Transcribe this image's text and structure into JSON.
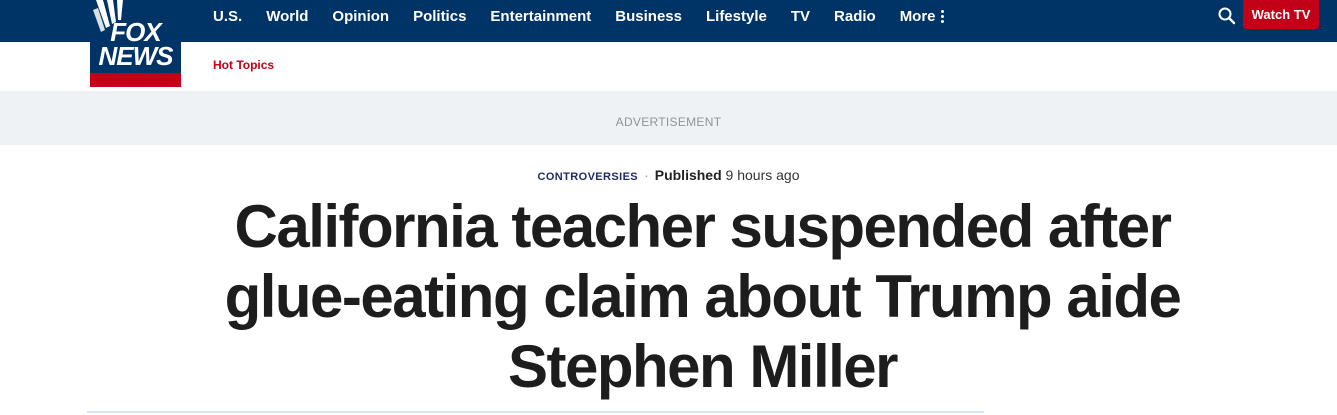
{
  "brand": {
    "logo_line1": "FOX",
    "logo_line2": "NEWS",
    "colors": {
      "navy": "#003366",
      "red": "#c20017"
    }
  },
  "nav": {
    "items": [
      "U.S.",
      "World",
      "Opinion",
      "Politics",
      "Entertainment",
      "Business",
      "Lifestyle",
      "TV",
      "Radio"
    ],
    "more_label": "More",
    "search_icon": "search-icon",
    "watch_tv_label": "Watch TV"
  },
  "subnav": {
    "hot_topics_label": "Hot Topics"
  },
  "ad": {
    "label": "ADVERTISEMENT"
  },
  "article": {
    "category": "CONTROVERSIES",
    "separator": "·",
    "published_label": "Published",
    "published_ago": "9 hours ago",
    "headline": "California teacher suspended after glue-eating claim about Trump aide Stephen Miller"
  }
}
